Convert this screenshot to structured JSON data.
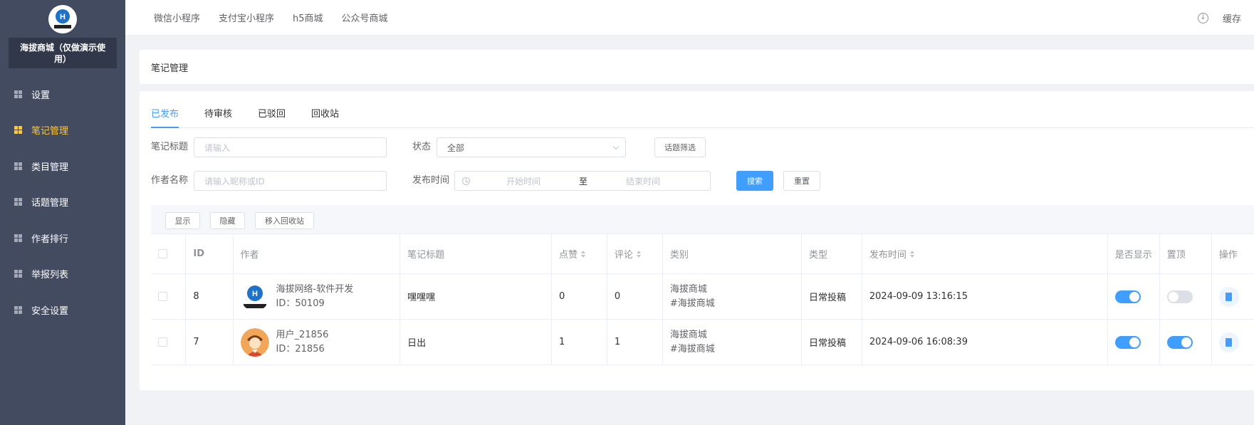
{
  "sidebar": {
    "shop_name": "海拔商城（仅做演示使用）",
    "menu": [
      {
        "label": "设置",
        "active": false
      },
      {
        "label": "笔记管理",
        "active": true
      },
      {
        "label": "类目管理",
        "active": false
      },
      {
        "label": "话题管理",
        "active": false
      },
      {
        "label": "作者排行",
        "active": false
      },
      {
        "label": "举报列表",
        "active": false
      },
      {
        "label": "安全设置",
        "active": false
      }
    ]
  },
  "topbar": {
    "nav": [
      "微信小程序",
      "支付宝小程序",
      "h5商城",
      "公众号商城"
    ],
    "cache_label": "缓存"
  },
  "breadcrumb": "笔记管理",
  "tabs": [
    "已发布",
    "待审核",
    "已驳回",
    "回收站"
  ],
  "filters": {
    "title_label": "笔记标题",
    "title_placeholder": "请输入",
    "status_label": "状态",
    "status_value": "全部",
    "topic_filter_btn": "话题筛选",
    "author_label": "作者名称",
    "author_placeholder": "请输入昵称或ID",
    "time_label": "发布时间",
    "start_placeholder": "开始时间",
    "range_sep": "至",
    "end_placeholder": "结束时间",
    "search_btn": "搜索",
    "reset_btn": "重置"
  },
  "actions": [
    "显示",
    "隐藏",
    "移入回收站"
  ],
  "table": {
    "headers": [
      "ID",
      "作者",
      "笔记标题",
      "点赞",
      "评论",
      "类别",
      "类型",
      "发布时间",
      "是否显示",
      "置顶",
      "操作"
    ],
    "rows": [
      {
        "id": "8",
        "author_name": "海拔网络-软件开发",
        "author_id": "ID：50109",
        "title": "嘿嘿嘿",
        "likes": "0",
        "comments": "0",
        "cat_shop": "海拔商城",
        "cat_topic": "#海拔商城",
        "type": "日常投稿",
        "time": "2024-09-09 13:16:15",
        "show": true,
        "top": false,
        "avatar": "logo"
      },
      {
        "id": "7",
        "author_name": "用户_21856",
        "author_id": "ID：21856",
        "title": "日出",
        "likes": "1",
        "comments": "1",
        "cat_shop": "海拔商城",
        "cat_topic": "#海拔商城",
        "type": "日常投稿",
        "time": "2024-09-06 16:08:39",
        "show": true,
        "top": true,
        "avatar": "user"
      }
    ]
  },
  "colors": {
    "sidebar_bg": "#434b60",
    "active": "#ffc73a",
    "primary": "#409eff"
  }
}
